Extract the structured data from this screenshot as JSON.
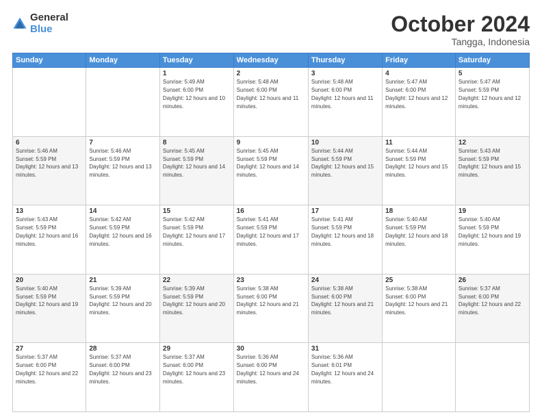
{
  "logo": {
    "general": "General",
    "blue": "Blue"
  },
  "header": {
    "month": "October 2024",
    "location": "Tangga, Indonesia"
  },
  "days_of_week": [
    "Sunday",
    "Monday",
    "Tuesday",
    "Wednesday",
    "Thursday",
    "Friday",
    "Saturday"
  ],
  "weeks": [
    [
      {
        "day": "",
        "sunrise": "",
        "sunset": "",
        "daylight": ""
      },
      {
        "day": "",
        "sunrise": "",
        "sunset": "",
        "daylight": ""
      },
      {
        "day": "1",
        "sunrise": "Sunrise: 5:49 AM",
        "sunset": "Sunset: 6:00 PM",
        "daylight": "Daylight: 12 hours and 10 minutes."
      },
      {
        "day": "2",
        "sunrise": "Sunrise: 5:48 AM",
        "sunset": "Sunset: 6:00 PM",
        "daylight": "Daylight: 12 hours and 11 minutes."
      },
      {
        "day": "3",
        "sunrise": "Sunrise: 5:48 AM",
        "sunset": "Sunset: 6:00 PM",
        "daylight": "Daylight: 12 hours and 11 minutes."
      },
      {
        "day": "4",
        "sunrise": "Sunrise: 5:47 AM",
        "sunset": "Sunset: 6:00 PM",
        "daylight": "Daylight: 12 hours and 12 minutes."
      },
      {
        "day": "5",
        "sunrise": "Sunrise: 5:47 AM",
        "sunset": "Sunset: 5:59 PM",
        "daylight": "Daylight: 12 hours and 12 minutes."
      }
    ],
    [
      {
        "day": "6",
        "sunrise": "Sunrise: 5:46 AM",
        "sunset": "Sunset: 5:59 PM",
        "daylight": "Daylight: 12 hours and 13 minutes."
      },
      {
        "day": "7",
        "sunrise": "Sunrise: 5:46 AM",
        "sunset": "Sunset: 5:59 PM",
        "daylight": "Daylight: 12 hours and 13 minutes."
      },
      {
        "day": "8",
        "sunrise": "Sunrise: 5:45 AM",
        "sunset": "Sunset: 5:59 PM",
        "daylight": "Daylight: 12 hours and 14 minutes."
      },
      {
        "day": "9",
        "sunrise": "Sunrise: 5:45 AM",
        "sunset": "Sunset: 5:59 PM",
        "daylight": "Daylight: 12 hours and 14 minutes."
      },
      {
        "day": "10",
        "sunrise": "Sunrise: 5:44 AM",
        "sunset": "Sunset: 5:59 PM",
        "daylight": "Daylight: 12 hours and 15 minutes."
      },
      {
        "day": "11",
        "sunrise": "Sunrise: 5:44 AM",
        "sunset": "Sunset: 5:59 PM",
        "daylight": "Daylight: 12 hours and 15 minutes."
      },
      {
        "day": "12",
        "sunrise": "Sunrise: 5:43 AM",
        "sunset": "Sunset: 5:59 PM",
        "daylight": "Daylight: 12 hours and 15 minutes."
      }
    ],
    [
      {
        "day": "13",
        "sunrise": "Sunrise: 5:43 AM",
        "sunset": "Sunset: 5:59 PM",
        "daylight": "Daylight: 12 hours and 16 minutes."
      },
      {
        "day": "14",
        "sunrise": "Sunrise: 5:42 AM",
        "sunset": "Sunset: 5:59 PM",
        "daylight": "Daylight: 12 hours and 16 minutes."
      },
      {
        "day": "15",
        "sunrise": "Sunrise: 5:42 AM",
        "sunset": "Sunset: 5:59 PM",
        "daylight": "Daylight: 12 hours and 17 minutes."
      },
      {
        "day": "16",
        "sunrise": "Sunrise: 5:41 AM",
        "sunset": "Sunset: 5:59 PM",
        "daylight": "Daylight: 12 hours and 17 minutes."
      },
      {
        "day": "17",
        "sunrise": "Sunrise: 5:41 AM",
        "sunset": "Sunset: 5:59 PM",
        "daylight": "Daylight: 12 hours and 18 minutes."
      },
      {
        "day": "18",
        "sunrise": "Sunrise: 5:40 AM",
        "sunset": "Sunset: 5:59 PM",
        "daylight": "Daylight: 12 hours and 18 minutes."
      },
      {
        "day": "19",
        "sunrise": "Sunrise: 5:40 AM",
        "sunset": "Sunset: 5:59 PM",
        "daylight": "Daylight: 12 hours and 19 minutes."
      }
    ],
    [
      {
        "day": "20",
        "sunrise": "Sunrise: 5:40 AM",
        "sunset": "Sunset: 5:59 PM",
        "daylight": "Daylight: 12 hours and 19 minutes."
      },
      {
        "day": "21",
        "sunrise": "Sunrise: 5:39 AM",
        "sunset": "Sunset: 5:59 PM",
        "daylight": "Daylight: 12 hours and 20 minutes."
      },
      {
        "day": "22",
        "sunrise": "Sunrise: 5:39 AM",
        "sunset": "Sunset: 5:59 PM",
        "daylight": "Daylight: 12 hours and 20 minutes."
      },
      {
        "day": "23",
        "sunrise": "Sunrise: 5:38 AM",
        "sunset": "Sunset: 6:00 PM",
        "daylight": "Daylight: 12 hours and 21 minutes."
      },
      {
        "day": "24",
        "sunrise": "Sunrise: 5:38 AM",
        "sunset": "Sunset: 6:00 PM",
        "daylight": "Daylight: 12 hours and 21 minutes."
      },
      {
        "day": "25",
        "sunrise": "Sunrise: 5:38 AM",
        "sunset": "Sunset: 6:00 PM",
        "daylight": "Daylight: 12 hours and 21 minutes."
      },
      {
        "day": "26",
        "sunrise": "Sunrise: 5:37 AM",
        "sunset": "Sunset: 6:00 PM",
        "daylight": "Daylight: 12 hours and 22 minutes."
      }
    ],
    [
      {
        "day": "27",
        "sunrise": "Sunrise: 5:37 AM",
        "sunset": "Sunset: 6:00 PM",
        "daylight": "Daylight: 12 hours and 22 minutes."
      },
      {
        "day": "28",
        "sunrise": "Sunrise: 5:37 AM",
        "sunset": "Sunset: 6:00 PM",
        "daylight": "Daylight: 12 hours and 23 minutes."
      },
      {
        "day": "29",
        "sunrise": "Sunrise: 5:37 AM",
        "sunset": "Sunset: 6:00 PM",
        "daylight": "Daylight: 12 hours and 23 minutes."
      },
      {
        "day": "30",
        "sunrise": "Sunrise: 5:36 AM",
        "sunset": "Sunset: 6:00 PM",
        "daylight": "Daylight: 12 hours and 24 minutes."
      },
      {
        "day": "31",
        "sunrise": "Sunrise: 5:36 AM",
        "sunset": "Sunset: 6:01 PM",
        "daylight": "Daylight: 12 hours and 24 minutes."
      },
      {
        "day": "",
        "sunrise": "",
        "sunset": "",
        "daylight": ""
      },
      {
        "day": "",
        "sunrise": "",
        "sunset": "",
        "daylight": ""
      }
    ]
  ]
}
